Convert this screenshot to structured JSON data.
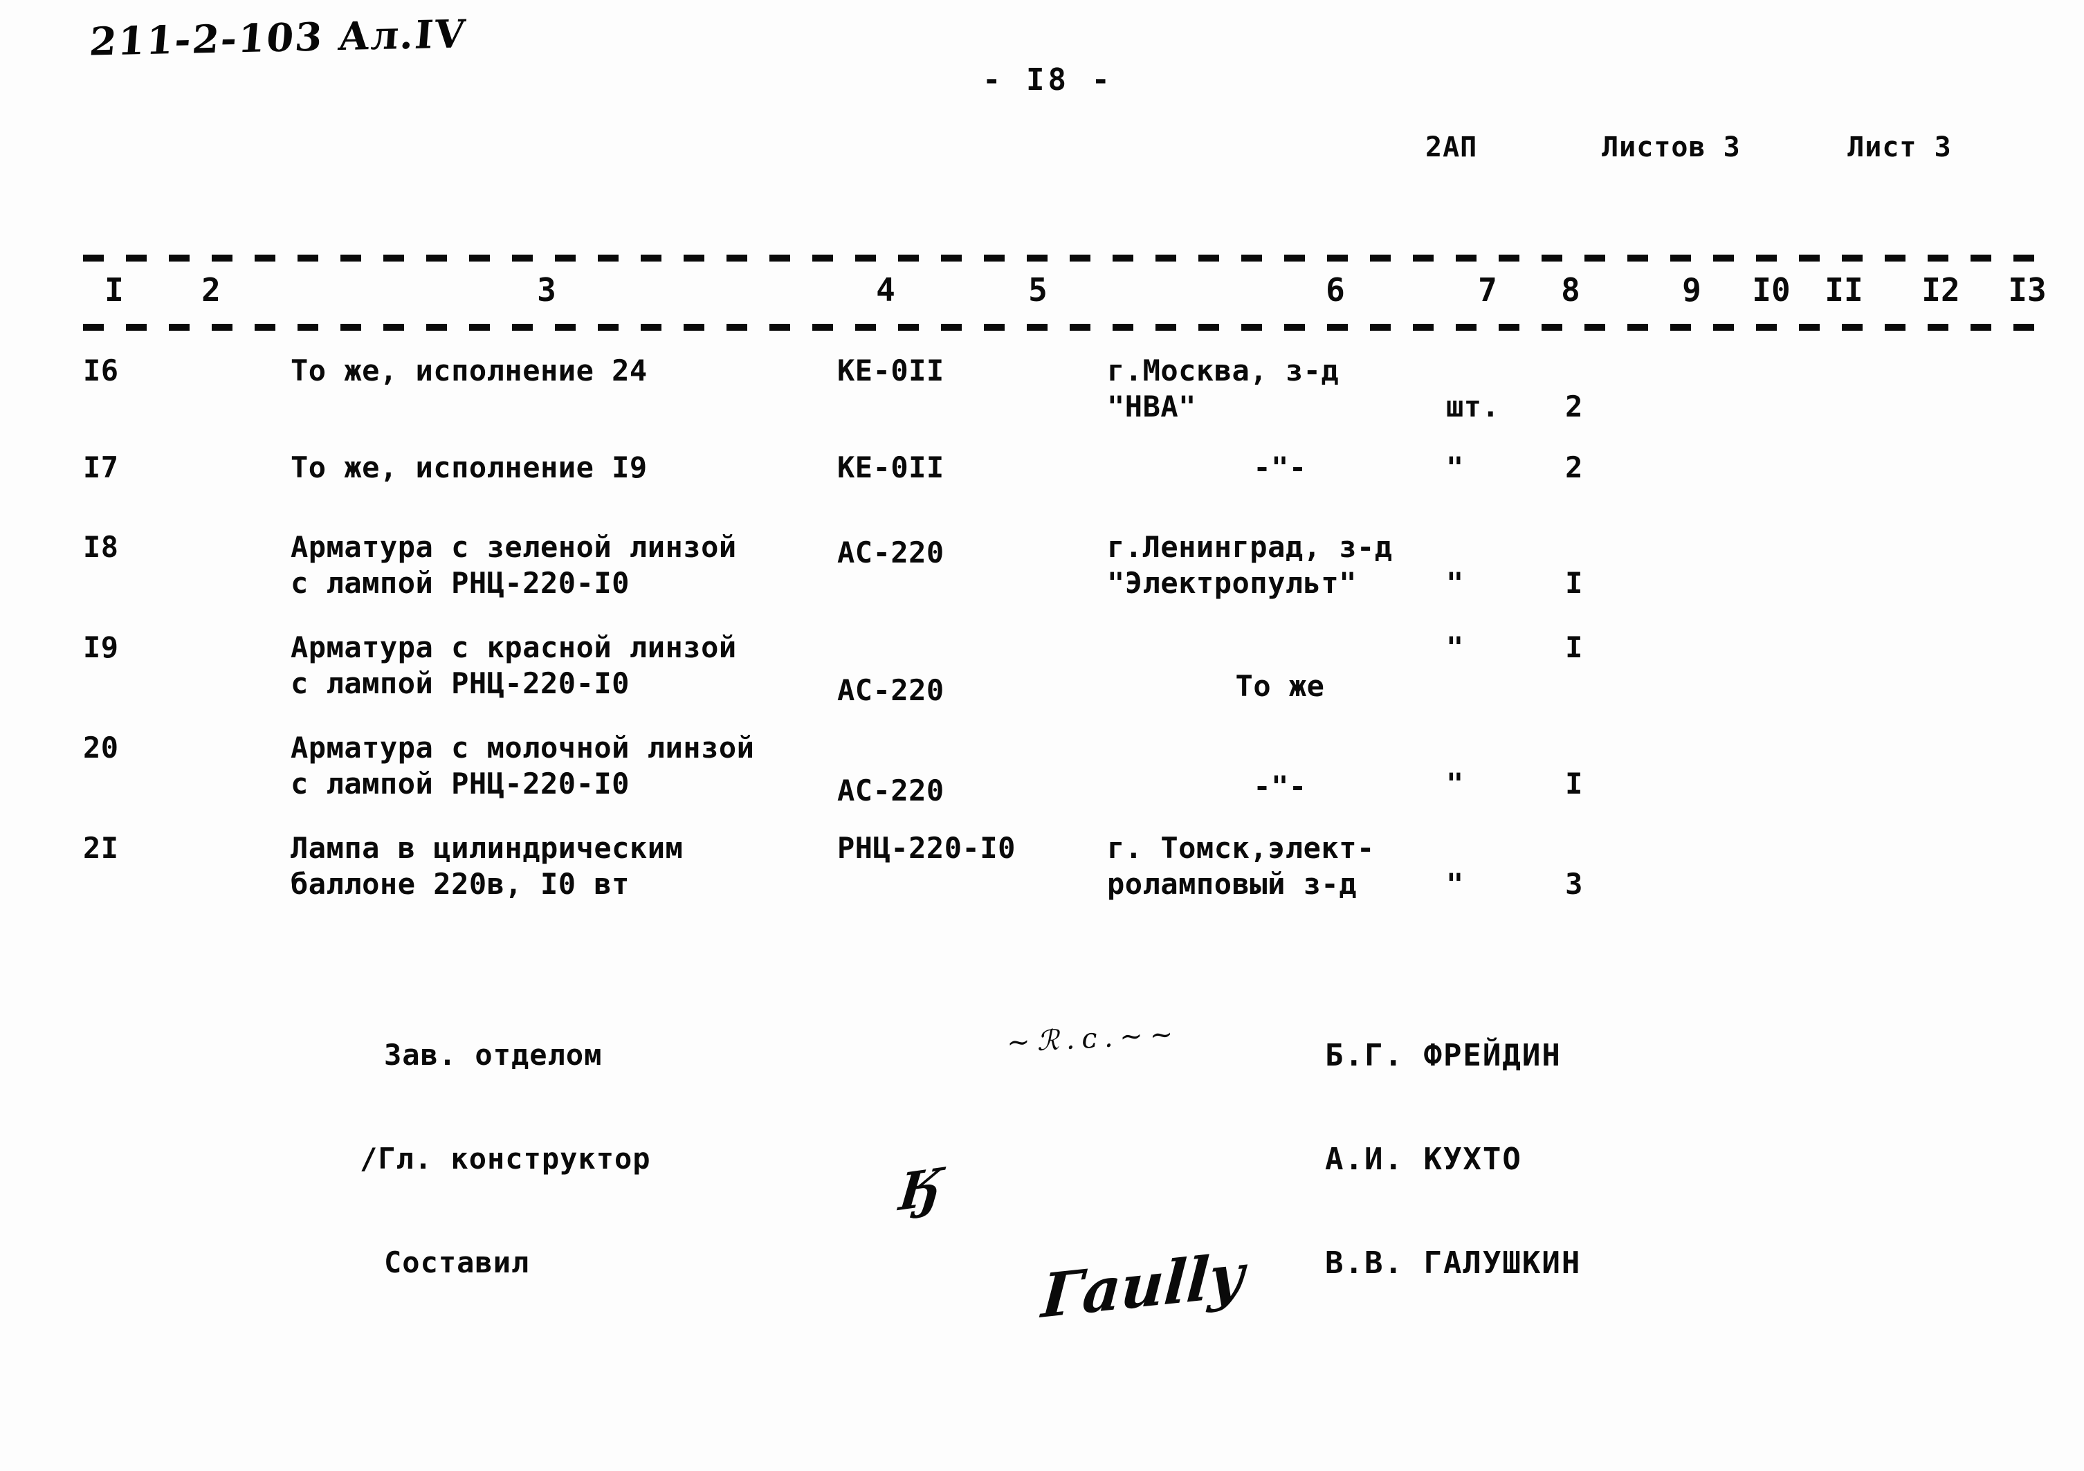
{
  "document": {
    "handwritten_code": "211-2-103  Ал.IV",
    "page_number": "- I8 -",
    "sheet_header": {
      "mark": "2АП",
      "sheets_total": "Листов 3",
      "sheet_current": "Лист 3"
    }
  },
  "table": {
    "column_numbers": [
      "I",
      "2",
      "3",
      "4",
      "5",
      "6",
      "7",
      "8",
      "9",
      "I0",
      "II",
      "I2",
      "I3"
    ],
    "rows": [
      {
        "num": "I6",
        "name": "То же, исполнение 24",
        "type": "КЕ-0II",
        "place": "г.Москва, з-д\n\"НВА\"",
        "unit": "шт.",
        "qty": "2"
      },
      {
        "num": "I7",
        "name": "То же, исполнение I9",
        "type": "КЕ-0II",
        "place": "-\"-",
        "unit": "\"",
        "qty": "2"
      },
      {
        "num": "I8",
        "name": "Арматура с зеленой линзой\nс лампой РНЦ-220-I0",
        "type": "АС-220",
        "place": "г.Ленинград, з-д\n\"Электропульт\"",
        "unit": "\"",
        "qty": "I"
      },
      {
        "num": "I9",
        "name": "Арматура с красной линзой\nс лампой РНЦ-220-I0",
        "type": "АС-220",
        "place": "То же",
        "unit": "\"",
        "qty": "I"
      },
      {
        "num": "20",
        "name": "Арматура с молочной линзой\nс лампой РНЦ-220-I0",
        "type": "АС-220",
        "place": "-\"-",
        "unit": "\"",
        "qty": "I"
      },
      {
        "num": "2I",
        "name": "Лампа в цилиндрическим\nбаллоне 220в, I0 вт",
        "type": "РНЦ-220-I0",
        "place": "г. Томск,элект-\nроламповый з-д",
        "unit": "\"",
        "qty": "3"
      }
    ]
  },
  "signatures": [
    {
      "role": "Зав. отделом",
      "name": "Б.Г. ФРЕЙДИН",
      "signature_glyph": "~ℛ.ᴄ.~~"
    },
    {
      "role": "/Гл. конструктор",
      "name": "А.И. КУХТО",
      "signature_glyph": "Ӄ"
    },
    {
      "role": "Составил",
      "name": "В.В. ГАЛУШКИН",
      "signature_glyph": "Гаиllу"
    }
  ]
}
